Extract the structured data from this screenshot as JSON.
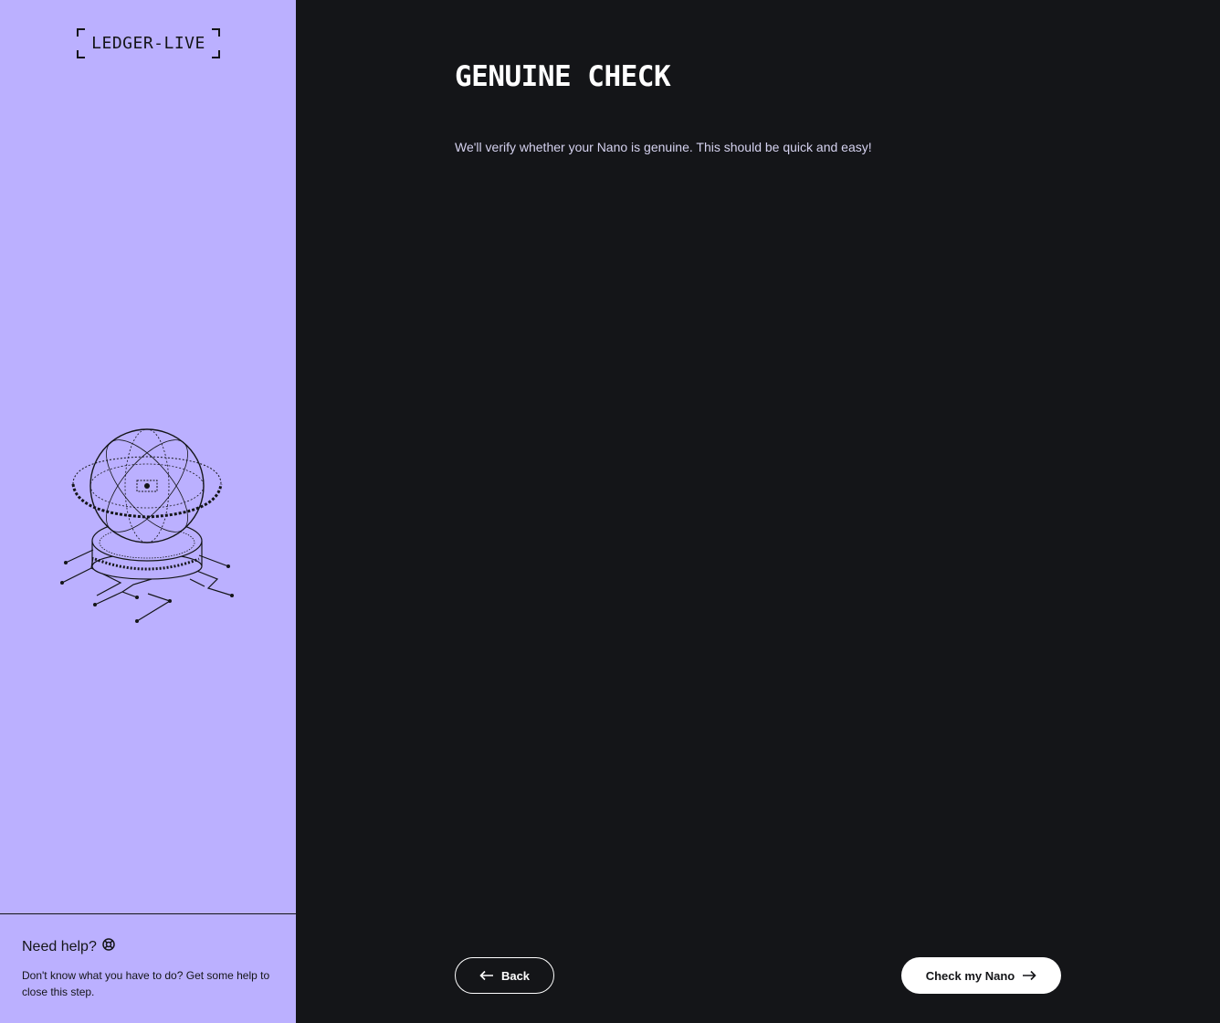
{
  "sidebar": {
    "logo_text": "LEDGER-LIVE",
    "illustration_icon": "genuine-check-orb-icon",
    "help": {
      "title": "Need help?",
      "icon": "lifebuoy-icon",
      "description": "Don't know what you have to do? Get some help to close this step."
    }
  },
  "main": {
    "title": "GENUINE CHECK",
    "description": "We'll verify whether your Nano is genuine. This should be quick and easy!"
  },
  "footer": {
    "back_label": "Back",
    "back_icon": "arrow-left-icon",
    "next_label": "Check my Nano",
    "next_icon": "arrow-right-icon"
  },
  "colors": {
    "sidebar_bg": "#bbb0ff",
    "main_bg": "#141518",
    "text_dark": "#141518",
    "text_light": "#ffffff"
  }
}
